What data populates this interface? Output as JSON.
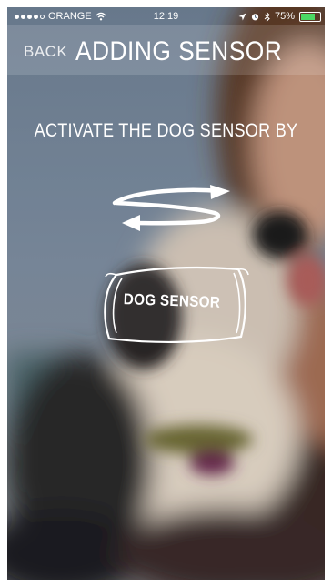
{
  "status_bar": {
    "carrier": "ORANGE",
    "time": "12:19",
    "battery_percent": "75%",
    "battery_level": 0.75,
    "signal_bars_filled": 4,
    "signal_bars_total": 5
  },
  "nav": {
    "back_label": "BACK",
    "title": "ADDING SENSOR"
  },
  "main": {
    "instruction": "ACTIVATE THE DOG SENSOR BY",
    "sensor_label": "DOG SENSOR"
  },
  "icons": {
    "wifi": "wifi-icon",
    "location": "location-arrow-icon",
    "alarm": "alarm-icon",
    "bluetooth": "bluetooth-icon",
    "battery": "battery-icon",
    "shake": "shake-arrows-icon",
    "sensor": "dog-sensor-icon"
  },
  "colors": {
    "text": "#ffffff",
    "battery_fill": "#4cd964"
  }
}
